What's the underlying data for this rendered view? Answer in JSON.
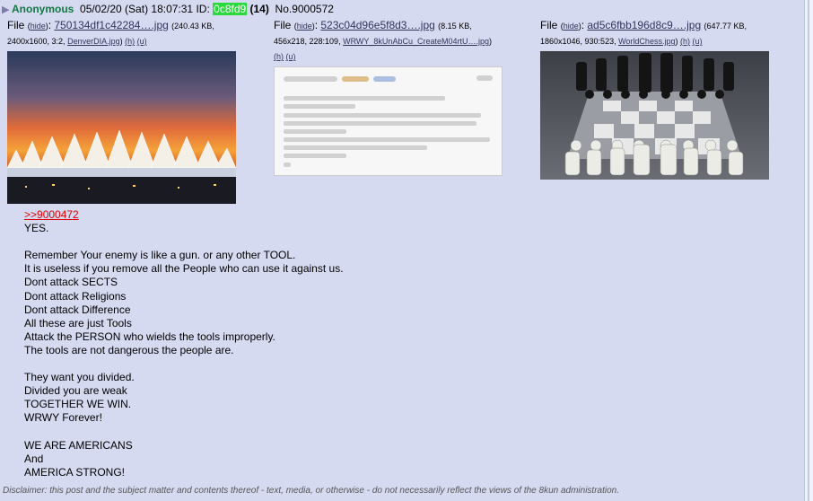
{
  "post": {
    "name": "Anonymous",
    "date": "05/02/20 (Sat) 18:07:31",
    "id_label": "ID:",
    "id": "0c8fd9",
    "count": "(14)",
    "number": "No.9000572"
  },
  "files": [
    {
      "label": "File",
      "hide": "hide",
      "filename": "750134df1c42284….jpg",
      "size": "240.43 KB,",
      "dims": "2400x1600, 3:2,",
      "original": "DenverDIA.jpg",
      "h": "(h)",
      "u": "(u)"
    },
    {
      "label": "File",
      "hide": "hide",
      "filename": "523c04d96e5f8d3….jpg",
      "size": "8.15 KB,",
      "dims": "456x218, 228:109,",
      "original": "WRWY_8kUnAbCu_CreateM04rtU….jpg",
      "h": "(h)",
      "u": "(u)"
    },
    {
      "label": "File",
      "hide": "hide",
      "filename": "ad5c6fbb196d8c9….jpg",
      "size": "647.77 KB,",
      "dims": "1860x1046, 930:523,",
      "original": "WorldChess.jpg",
      "h": "(h)",
      "u": "(u)"
    }
  ],
  "message": {
    "quote": ">>9000472",
    "lines": [
      "YES.",
      "",
      "Remember Your enemy is like a gun. or any other TOOL.",
      "It is useless if you remove all the People who can use it against us.",
      "Dont attack SECTS",
      "Dont attack Religions",
      "Dont attack Difference",
      "All these are just Tools",
      "Attack the PERSON who wields the tools improperly.",
      "The tools are not dangerous the people are.",
      "",
      "They want you divided.",
      "Divided you are weak",
      "TOGETHER WE WIN.",
      "WRWY Forever!",
      "",
      "WE ARE AMERICANS",
      "And",
      "AMERICA STRONG!"
    ]
  },
  "disclaimer": "Disclaimer: this post and the subject matter and contents thereof - text, media, or otherwise - do not necessarily reflect the views of the 8kun administration.",
  "colors": {
    "background": "#d6daf0",
    "name": "#117743",
    "id_bg": "#2ad93b",
    "link": "#34345c",
    "quote": "#dd0000"
  }
}
